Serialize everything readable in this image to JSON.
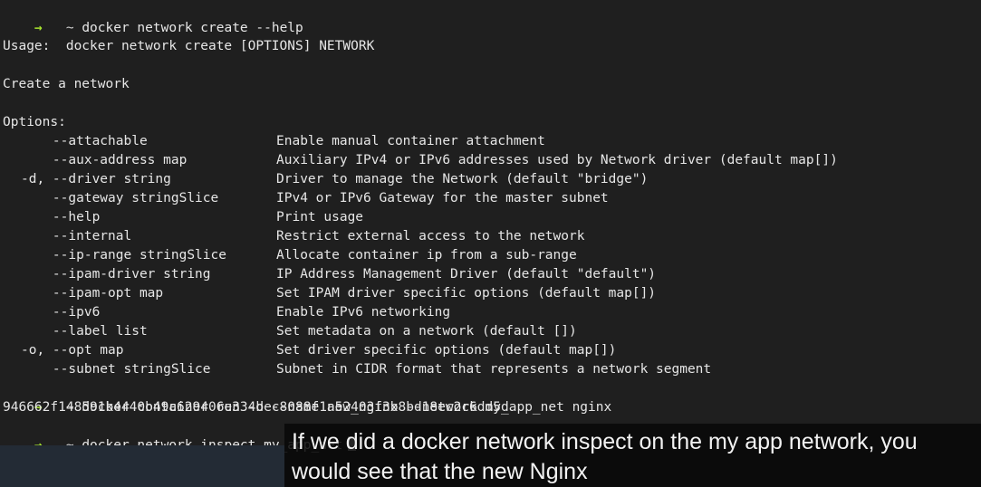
{
  "terminal": {
    "prompt_arrow": "→",
    "prompt_icon": "",
    "prompt_dir": "~",
    "cmd1": "docker network create --help",
    "usage": "Usage:  docker network create [OPTIONS] NETWORK",
    "description": "Create a network",
    "options_header": "Options:",
    "options": [
      {
        "flag": "    --attachable",
        "desc": "Enable manual container attachment"
      },
      {
        "flag": "    --aux-address map",
        "desc": "Auxiliary IPv4 or IPv6 addresses used by Network driver (default map[])"
      },
      {
        "flag": "-d, --driver string",
        "desc": "Driver to manage the Network (default \"bridge\")"
      },
      {
        "flag": "    --gateway stringSlice",
        "desc": "IPv4 or IPv6 Gateway for the master subnet"
      },
      {
        "flag": "    --help",
        "desc": "Print usage"
      },
      {
        "flag": "    --internal",
        "desc": "Restrict external access to the network"
      },
      {
        "flag": "    --ip-range stringSlice",
        "desc": "Allocate container ip from a sub-range"
      },
      {
        "flag": "    --ipam-driver string",
        "desc": "IP Address Management Driver (default \"default\")"
      },
      {
        "flag": "    --ipam-opt map",
        "desc": "Set IPAM driver specific options (default map[])"
      },
      {
        "flag": "    --ipv6",
        "desc": "Enable IPv6 networking"
      },
      {
        "flag": "    --label list",
        "desc": "Set metadata on a network (default [])"
      },
      {
        "flag": "-o, --opt map",
        "desc": "Set driver specific options (default map[])"
      },
      {
        "flag": "    --subnet stringSlice",
        "desc": "Subnet in CIDR format that represents a network segment"
      }
    ],
    "cmd2": "docker container run -d --name new_nginx --network my_app_net nginx",
    "container_id": "946662f148591b4440b49c629406e334bec8088f1a52403f3b8bd18ec2c6dd5d",
    "cmd3": "docker network inspect my_app_net"
  },
  "caption": {
    "line1": "If we did a docker network inspect on the my app network, you",
    "line2": "would see that the new Nginx"
  },
  "colors": {
    "background": "#1f1f1f",
    "text": "#e6e6e6",
    "prompt_arrow": "#a6e22e",
    "prompt_icon": "#4aa3ff",
    "caption_bg": "#080808"
  }
}
